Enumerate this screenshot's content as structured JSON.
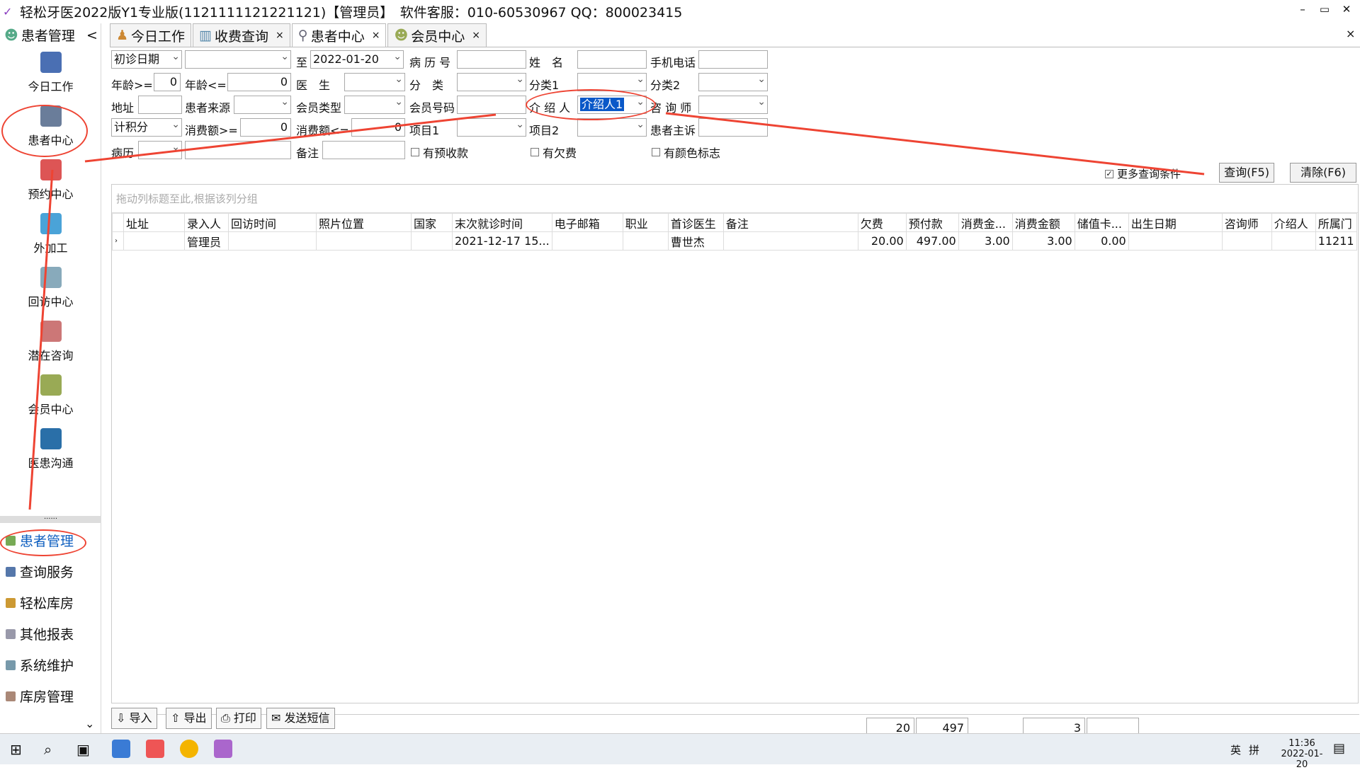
{
  "title": "轻松牙医2022版Y1专业版(1121111121221121)【管理员】　软件客服：010-60530967 QQ：800023415",
  "win": {
    "min": "–",
    "max": "▭",
    "close": "✕"
  },
  "sidebar": {
    "header": "患者管理",
    "collapse": "<",
    "tiles": [
      "今日工作",
      "患者中心",
      "预约中心",
      "外加工",
      "回访中心",
      "潜在咨询",
      "会员中心",
      "医患沟通"
    ],
    "dots": "......",
    "nav": [
      "患者管理",
      "查询服务",
      "轻松库房",
      "其他报表",
      "系统维护",
      "库房管理"
    ],
    "more": "⌄"
  },
  "tabs": [
    {
      "label": "今日工作",
      "close": ""
    },
    {
      "label": "收费查询",
      "close": "×"
    },
    {
      "label": "患者中心",
      "close": "×"
    },
    {
      "label": "会员中心",
      "close": "×"
    }
  ],
  "panel_close": "×",
  "form": {
    "r1": {
      "date_type": "初诊日期",
      "date_from": "",
      "to": "至",
      "date_to": "2022-01-20",
      "record_no": "病 历 号",
      "name": "姓　名",
      "phone": "手机电话"
    },
    "r2": {
      "age_ge": "年龄>=",
      "age_ge_v": "0",
      "age_le": "年龄<=",
      "age_le_v": "0",
      "doctor": "医　生",
      "category": "分　类",
      "cat1": "分类1",
      "cat2": "分类2"
    },
    "r3": {
      "address": "地址",
      "source": "患者来源",
      "member_type": "会员类型",
      "member_no": "会员号码",
      "referrer": "介 绍 人",
      "referrer_v": "介绍人1",
      "consultant": "咨 询 师"
    },
    "r4": {
      "points": "计积分",
      "spend_ge": "消费额>=",
      "spend_ge_v": "0",
      "spend_le": "消费额<=",
      "spend_le_v": "0",
      "item1": "项目1",
      "item2": "项目2",
      "complaint": "患者主诉"
    },
    "r5": {
      "history": "病历",
      "note": "备注",
      "prepay": "有预收款",
      "owe": "有欠费",
      "color": "有颜色标志"
    },
    "more": "更多查询条件",
    "query": "查询(F5)",
    "clear": "清除(F6)"
  },
  "grid": {
    "group_hint": "拖动列标题至此,根据该列分组",
    "headers": [
      "址址",
      "录入人",
      "回访时间",
      "照片位置",
      "国家",
      "末次就诊时间",
      "电子邮箱",
      "职业",
      "首诊医生",
      "备注",
      "欠费",
      "预付款",
      "消费金...",
      "消费金额",
      "储值卡...",
      "出生日期",
      "咨询师",
      "介绍人",
      "所属门"
    ],
    "rows": [
      [
        "",
        "管理员",
        "",
        "",
        "",
        "2021-12-17 15...",
        "",
        "",
        "曹世杰",
        "",
        "20.00",
        "497.00",
        "3.00",
        "3.00",
        "0.00",
        "",
        "",
        "",
        "11211"
      ]
    ],
    "totals": {
      "owe": "20",
      "prepay": "497",
      "spend": "3",
      "card": ""
    }
  },
  "toolbar": {
    "import": "导入",
    "export": "导出",
    "print": "打印",
    "sms": "发送短信"
  },
  "taskbar": {
    "time": "11:36",
    "date": "2022-01-20",
    "ime": "英",
    "ime2": "拼"
  }
}
